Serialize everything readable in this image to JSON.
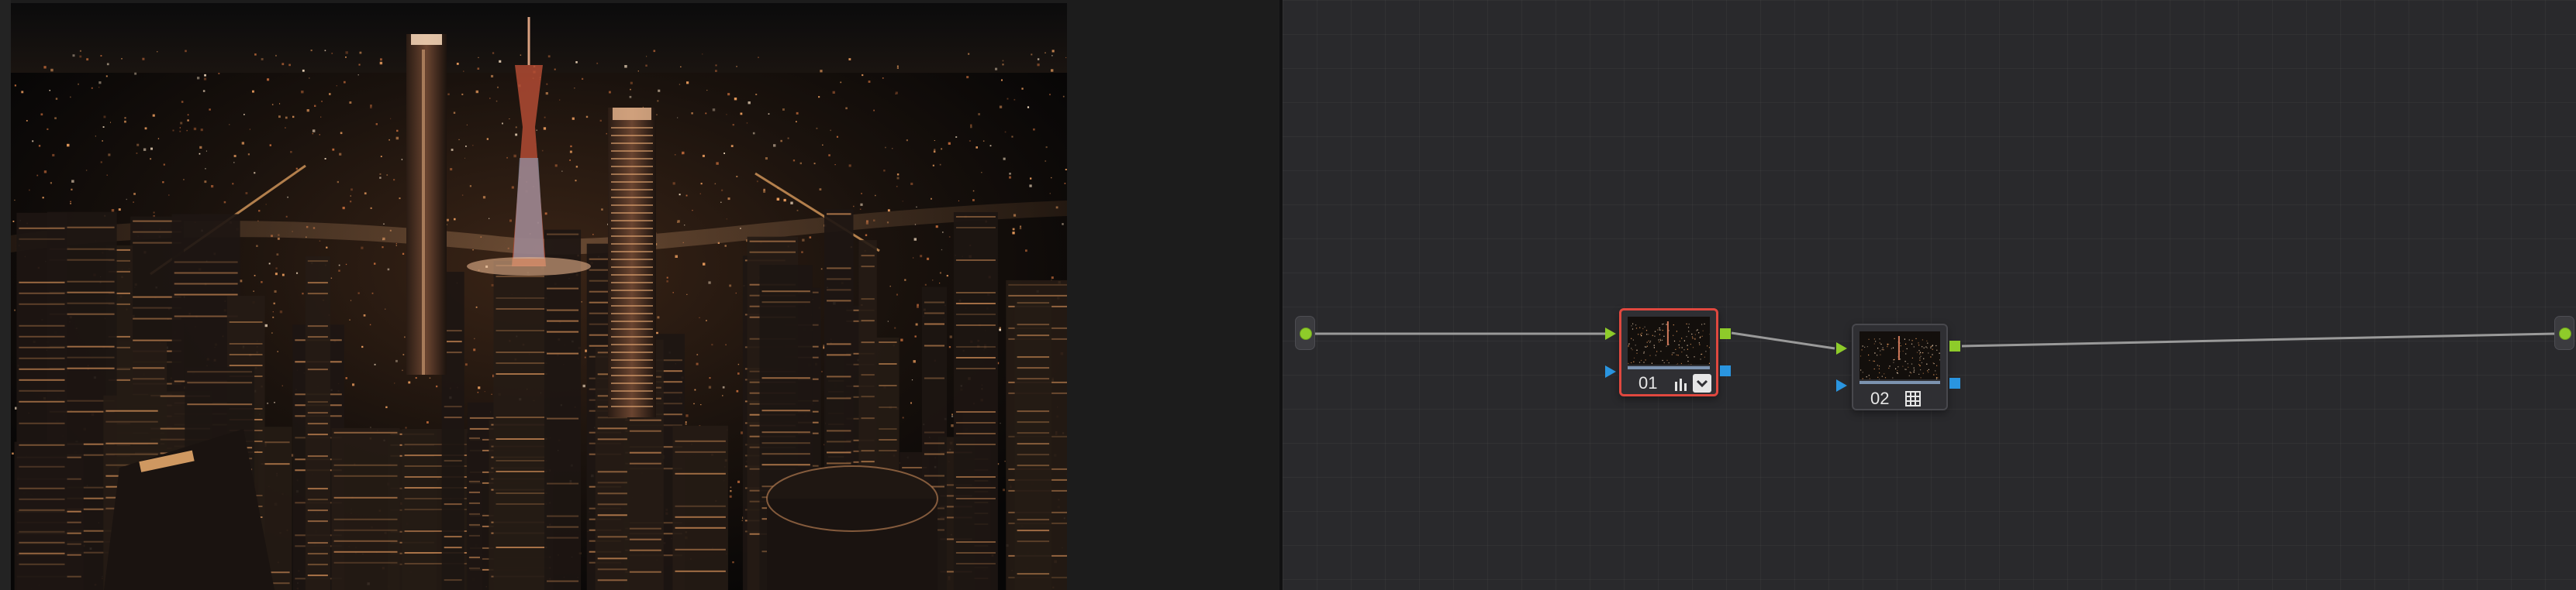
{
  "viewer": {
    "image_description": "night-aerial-city"
  },
  "node_graph": {
    "nodes": [
      {
        "label": "01",
        "tool_icon": "histogram-icon",
        "has_dropdown": true,
        "selected": true
      },
      {
        "label": "02",
        "tool_icon": "grid-icon",
        "has_dropdown": false,
        "selected": false
      }
    ],
    "colors": {
      "rgb_connection": "#8ecb2a",
      "alpha_connection": "#2a95e0",
      "selected_border": "#e0483f",
      "wire": "#9a9a9a"
    }
  }
}
